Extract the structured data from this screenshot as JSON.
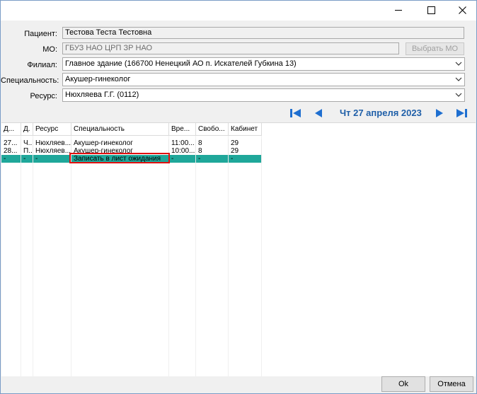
{
  "window": {
    "controls": {
      "minimize": "—",
      "maximize": "☐",
      "close": "✕"
    }
  },
  "form": {
    "patient_label": "Пациент:",
    "patient_value": "Тестова Теста Тестовна",
    "mo_label": "МО:",
    "mo_value": "ГБУЗ НАО ЦРП ЗР НАО",
    "select_mo_button": "Выбрать МО",
    "branch_label": "Филиал:",
    "branch_value": "Главное здание (166700 Ненецкий АО п. Искателей Губкина 13)",
    "specialty_label": "Специальность:",
    "specialty_value": "Акушер-гинеколог",
    "resource_label": "Ресурс:",
    "resource_value": "Нюхляева Г.Г. (0112)"
  },
  "nav": {
    "date": "Чт 27 апреля 2023"
  },
  "grid": {
    "headers": [
      "Д...",
      "Д.",
      "Ресурс",
      "Специальность",
      "Вре...",
      "Свобо...",
      "Кабинет"
    ],
    "rows": [
      [
        "27...",
        "Ч..",
        "Нюхляев...",
        "Акушер-гинеколог",
        "11:00...",
        "8",
        "29"
      ],
      [
        "28...",
        "П..",
        "Нюхляев...",
        "Акушер-гинеколог",
        "10:00...",
        "8",
        "29"
      ],
      [
        "-",
        "-",
        "-",
        "Записать в лист ожидания",
        "-",
        "-",
        "-"
      ]
    ]
  },
  "footer": {
    "ok": "Ok",
    "cancel": "Отмена"
  },
  "colors": {
    "selected_row": "#1fa79a",
    "date_text": "#1f5fa8",
    "nav_icon": "#1f6fd0",
    "highlight_border": "#e01010"
  }
}
